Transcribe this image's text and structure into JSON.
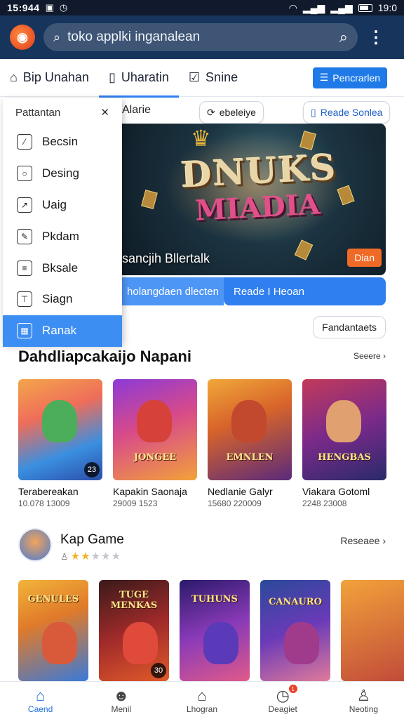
{
  "status": {
    "time": "15:944",
    "right_time": "19:0"
  },
  "header": {
    "search_text": "toko applki inganalean"
  },
  "tabs": [
    {
      "label": "Bip Unahan",
      "icon": "bag-icon"
    },
    {
      "label": "Uharatin",
      "icon": "phone-icon"
    },
    {
      "label": "Snine",
      "icon": "checkbox-icon"
    }
  ],
  "tab_cta": "Pencrarlen",
  "dropdown": {
    "title": "Pattantan",
    "items": [
      "Becsin",
      "Desing",
      "Uaig",
      "Pkdam",
      "Bksale",
      "Siagn",
      "Ranak"
    ],
    "active_index": 6
  },
  "hero": {
    "label": "Alarie",
    "chip1": "ebeleiye",
    "chip2": "Reade Sonlea",
    "logo_line1": "DNUKS",
    "logo_line2": "MIADIA",
    "caption": "sancjih Bllertalk",
    "cta": "Dian",
    "split_left": "holangdaen dlecten",
    "split_right": "Reade I Heoan"
  },
  "filter_pill": "Fandantaets",
  "section": {
    "title": "Dahdliapcakaijo Napani",
    "see_more": "Seeere"
  },
  "games": [
    {
      "name": "Terabereakan",
      "meta": "10.078 13009",
      "art": "",
      "badge": "23"
    },
    {
      "name": "Kapakin Saonaja",
      "meta": "29009 1523",
      "art": "JONGEE",
      "badge": ""
    },
    {
      "name": "Nedlanie Galyr",
      "meta": "15680 220009",
      "art": "EMNLEN",
      "badge": ""
    },
    {
      "name": "Viakara Gotoml",
      "meta": "2248 23008",
      "art": "HENGBAS",
      "badge": ""
    }
  ],
  "kap": {
    "name": "Kap Game",
    "rating": 2,
    "max": 5,
    "more": "Reseaee"
  },
  "games2": [
    {
      "art": "GENULES",
      "badge": ""
    },
    {
      "art": "TUGE MENKAS",
      "badge": "30"
    },
    {
      "art": "TUHUNS",
      "badge": ""
    },
    {
      "art": "CANAURO",
      "badge": ""
    }
  ],
  "bottom_nav": [
    {
      "label": "Caend",
      "icon": "home-icon"
    },
    {
      "label": "Menil",
      "icon": "person-icon"
    },
    {
      "label": "Lhogran",
      "icon": "bag-icon"
    },
    {
      "label": "Deagiet",
      "icon": "clock-icon",
      "badge": "1"
    },
    {
      "label": "Neoting",
      "icon": "user-icon"
    }
  ]
}
